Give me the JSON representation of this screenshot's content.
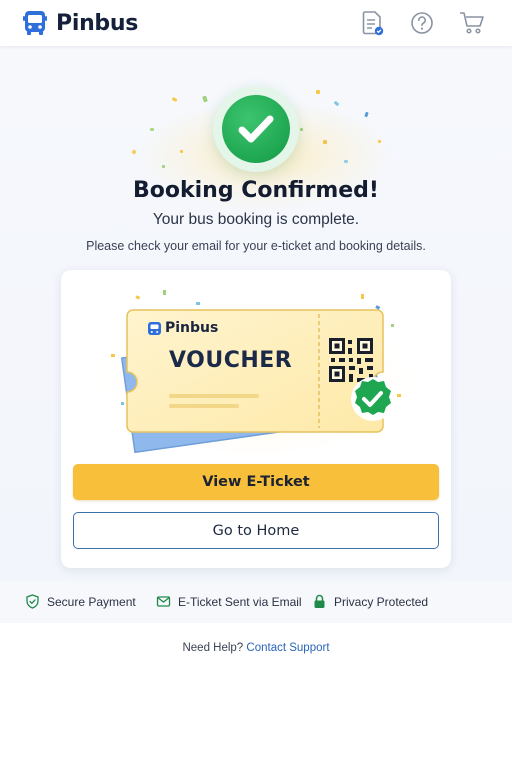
{
  "app": {
    "name": "Pinbus",
    "brand_color": "#2f6fdc",
    "icons": [
      "bus-logo-icon",
      "ticket-doc-icon",
      "help-icon",
      "cart-icon"
    ]
  },
  "confirmation": {
    "title": "Booking Confirmed!",
    "subtitle": "Your bus booking is complete.",
    "note": "Please check your email for your e-ticket and booking details.",
    "success_color": "#1ea651"
  },
  "voucher": {
    "brand": "Pinbus",
    "label": "VOUCHER"
  },
  "actions": {
    "primary_label": "View E-Ticket",
    "secondary_label": "Go to Home",
    "primary_color": "#f8bf3a",
    "secondary_border_color": "#3d6fa8"
  },
  "features": [
    {
      "label": "Secure Payment",
      "icon": "shield-check-icon"
    },
    {
      "label": "E-Ticket Sent via Email",
      "icon": "mail-icon"
    },
    {
      "label": "Privacy Protected",
      "icon": "lock-icon"
    }
  ],
  "help": {
    "text": "Need Help?",
    "link": "Contact Support"
  }
}
